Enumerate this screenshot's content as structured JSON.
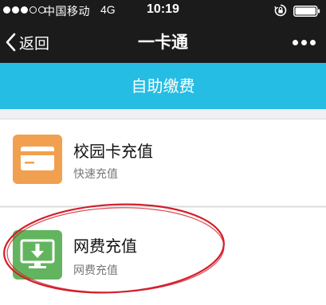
{
  "status_bar": {
    "carrier": "中国移动",
    "network": "4G",
    "time": "10:19",
    "signal_bars": 3,
    "signal_max": 5
  },
  "nav": {
    "back_label": "返回",
    "title": "一卡通",
    "more_icon": "more-dots-icon"
  },
  "header": {
    "title": "自助缴费"
  },
  "items": [
    {
      "title": "校园卡充值",
      "subtitle": "快速充值",
      "icon": "card-icon",
      "icon_color": "#f1a04f"
    },
    {
      "title": "网费充值",
      "subtitle": "网费充值",
      "icon": "monitor-download-icon",
      "icon_color": "#62b55e"
    }
  ],
  "colors": {
    "bar_background": "#1b1b1c",
    "header_background": "#25bde4",
    "annotation": "#d21f2a"
  }
}
